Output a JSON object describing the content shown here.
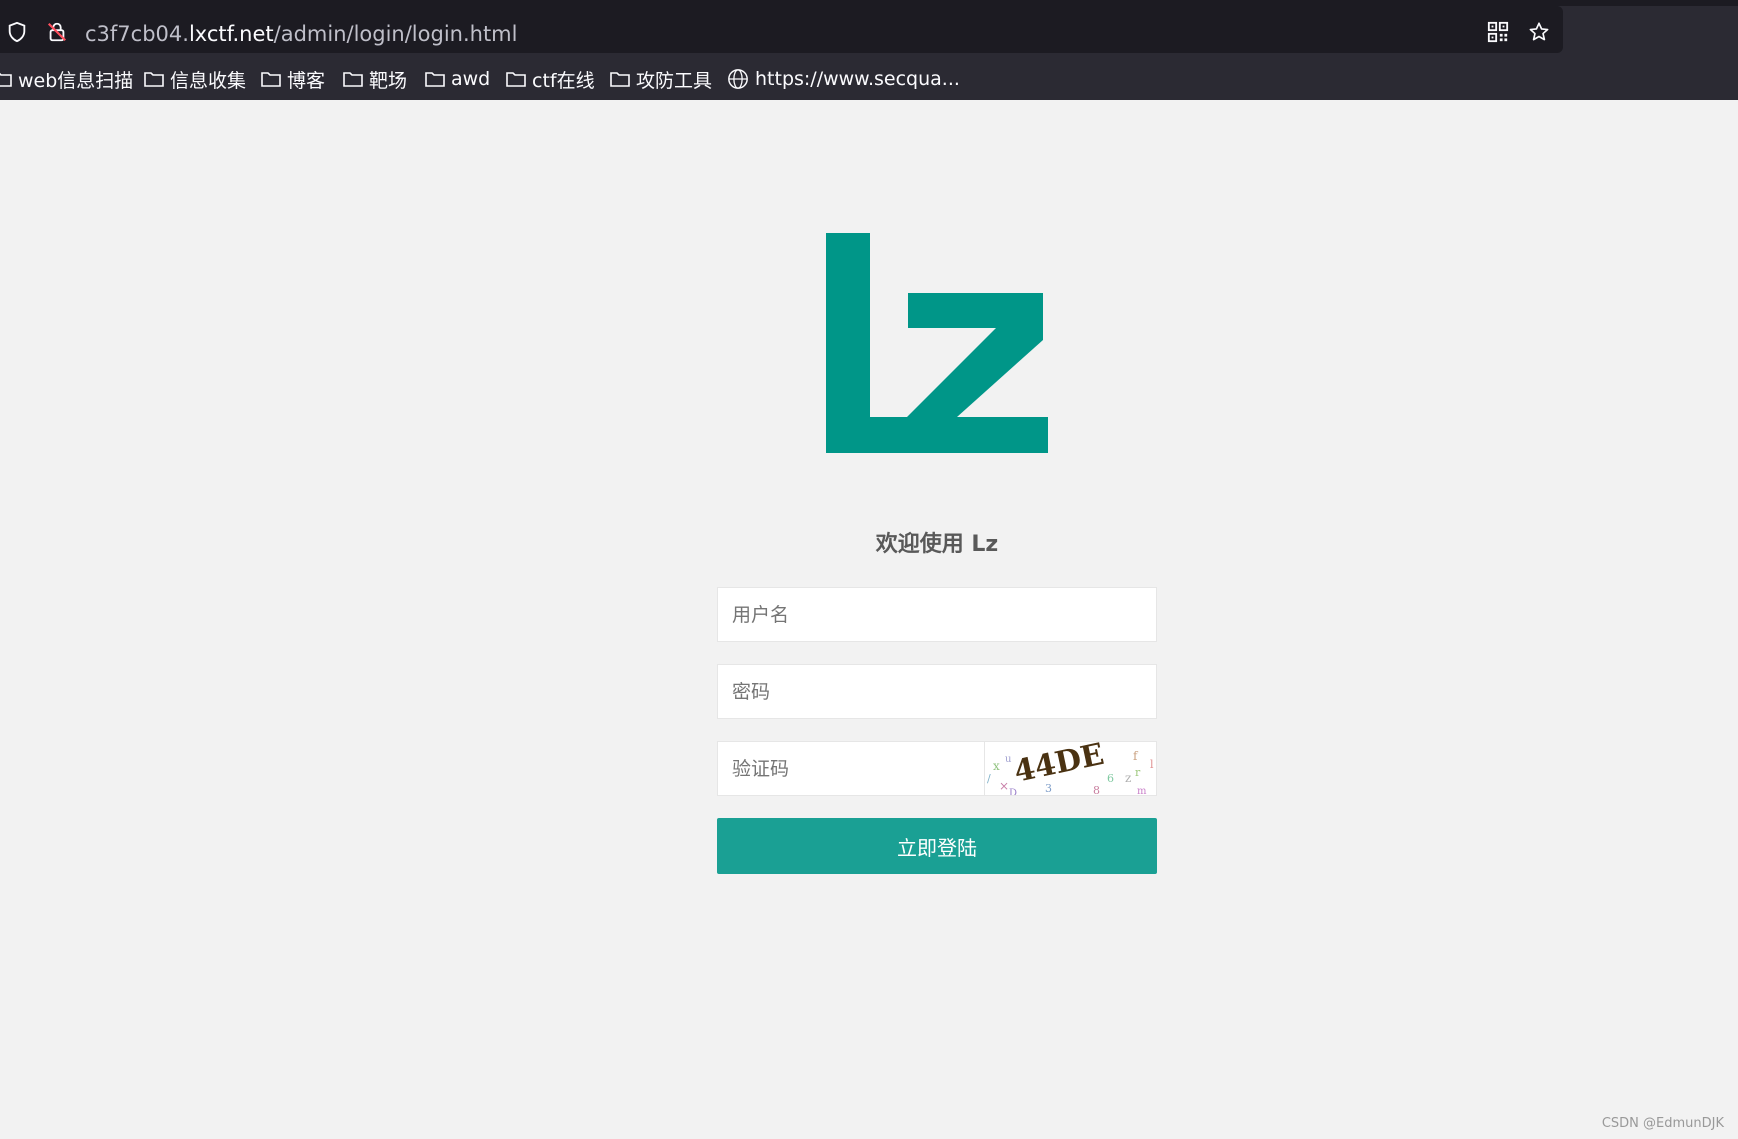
{
  "browser": {
    "url_prefix": "c3f7cb04.",
    "url_host": "lxctf.net",
    "url_path": "/admin/login/login.html",
    "bookmarks": [
      {
        "label": "web信息扫描",
        "icon": "folder-icon"
      },
      {
        "label": "信息收集",
        "icon": "folder-icon"
      },
      {
        "label": "博客",
        "icon": "folder-icon"
      },
      {
        "label": "靶场",
        "icon": "folder-icon"
      },
      {
        "label": "awd",
        "icon": "folder-icon"
      },
      {
        "label": "ctf在线",
        "icon": "folder-icon"
      },
      {
        "label": "攻防工具",
        "icon": "folder-icon"
      },
      {
        "label": "https://www.secqua...",
        "icon": "globe-icon"
      }
    ]
  },
  "login": {
    "logo_color": "#009688",
    "welcome": "欢迎使用 Lz",
    "username_placeholder": "用户名",
    "password_placeholder": "密码",
    "captcha_placeholder": "验证码",
    "captcha_text": "44DE",
    "submit_label": "立即登陆",
    "button_color": "#1aa094"
  },
  "watermark": "CSDN @EdmunDJK"
}
